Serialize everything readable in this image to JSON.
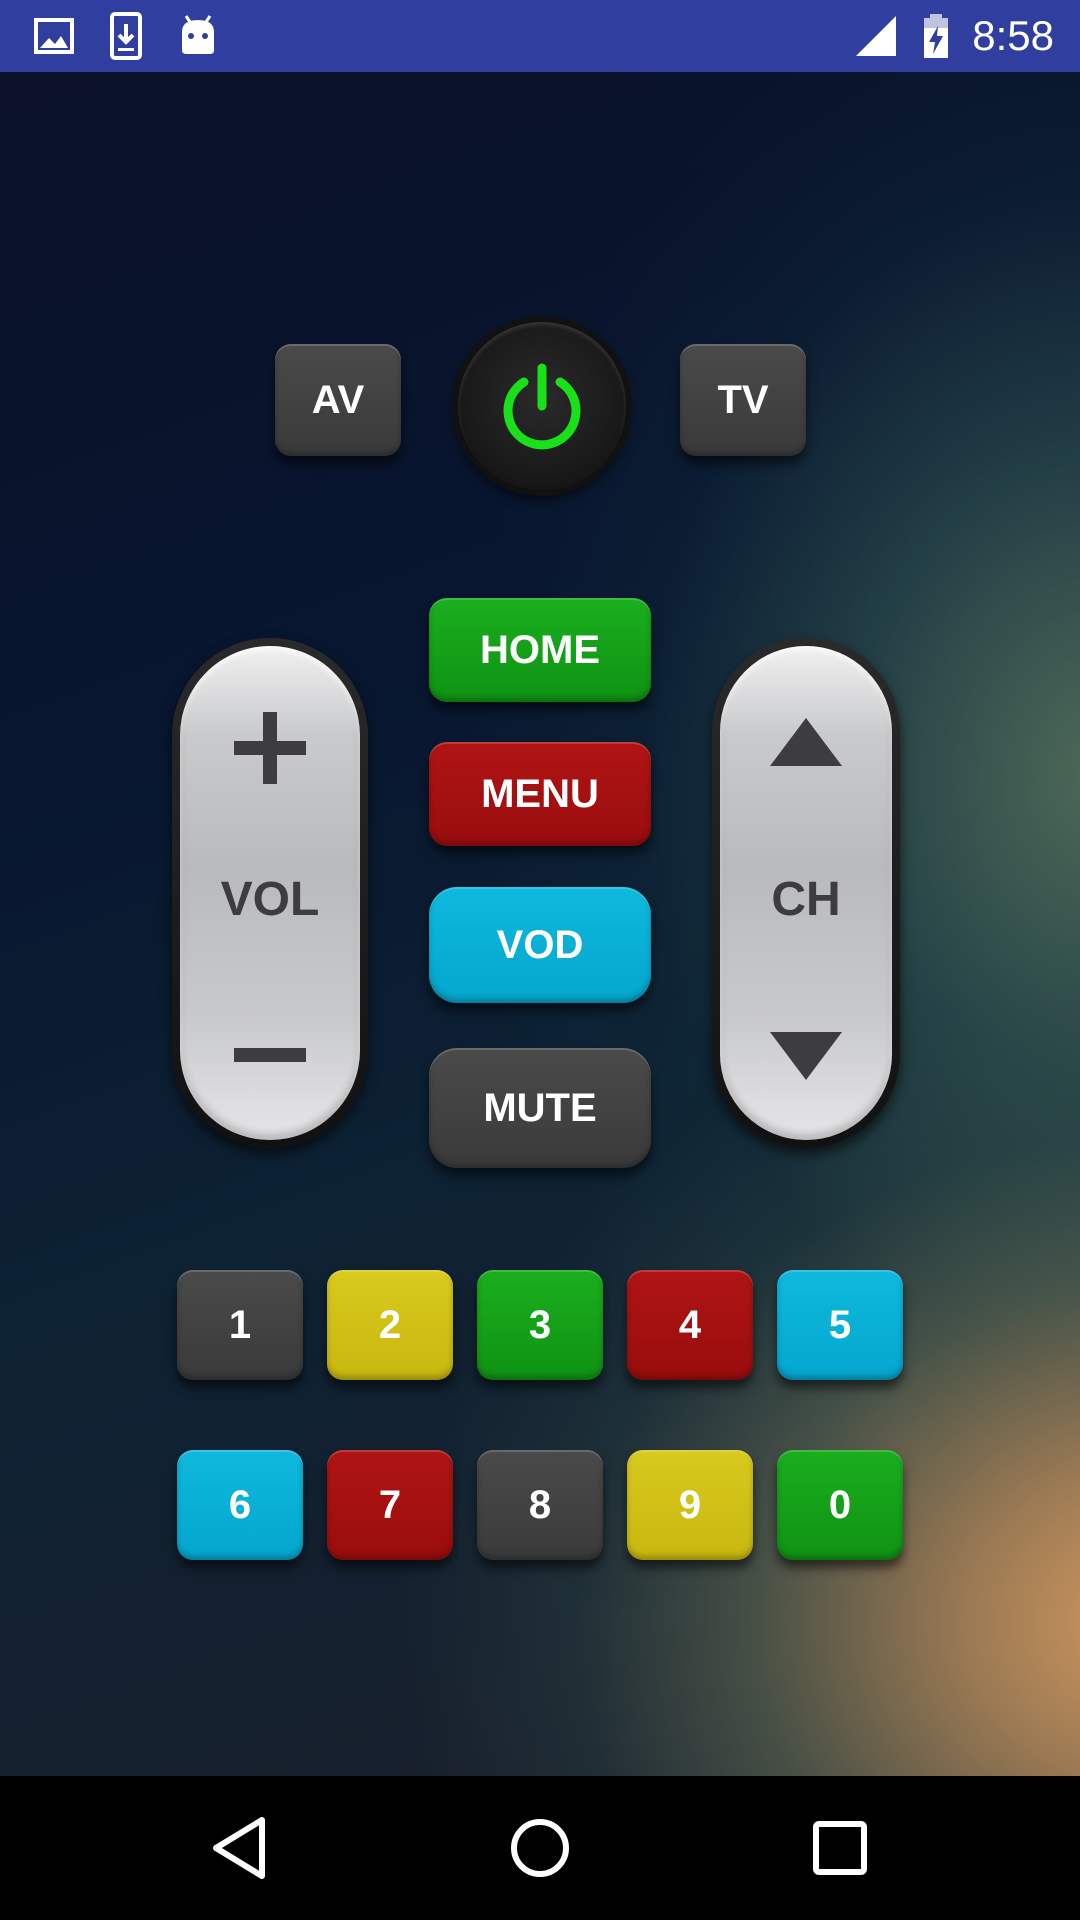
{
  "status_bar": {
    "icons": [
      "image-icon",
      "download-icon",
      "android-icon"
    ],
    "right_icons": [
      "signal-icon",
      "battery-charging-icon"
    ],
    "time": "8:58"
  },
  "top_row": {
    "av_label": "AV",
    "power_icon": "power-icon",
    "tv_label": "TV"
  },
  "center_buttons": [
    {
      "label": "HOME",
      "color": "#13a017"
    },
    {
      "label": "MENU",
      "color": "#a51111"
    },
    {
      "label": "VOD",
      "color": "#07b0d6"
    },
    {
      "label": "MUTE",
      "color": "#434343"
    }
  ],
  "volume": {
    "label": "VOL",
    "up_icon": "plus-icon",
    "down_icon": "minus-icon"
  },
  "channel": {
    "label": "CH",
    "up_icon": "triangle-up-icon",
    "down_icon": "triangle-down-icon"
  },
  "number_pad": {
    "row1": [
      {
        "label": "1",
        "color": "#434343"
      },
      {
        "label": "2",
        "color": "#d0c117"
      },
      {
        "label": "3",
        "color": "#13a017"
      },
      {
        "label": "4",
        "color": "#a51111"
      },
      {
        "label": "5",
        "color": "#07b0d6"
      }
    ],
    "row2": [
      {
        "label": "6",
        "color": "#07b0d6"
      },
      {
        "label": "7",
        "color": "#a51111"
      },
      {
        "label": "8",
        "color": "#434343"
      },
      {
        "label": "9",
        "color": "#d0c117"
      },
      {
        "label": "0",
        "color": "#13a017"
      }
    ]
  },
  "nav_bar": {
    "back_icon": "back-triangle-icon",
    "home_icon": "home-circle-icon",
    "recents_icon": "recents-square-icon"
  }
}
